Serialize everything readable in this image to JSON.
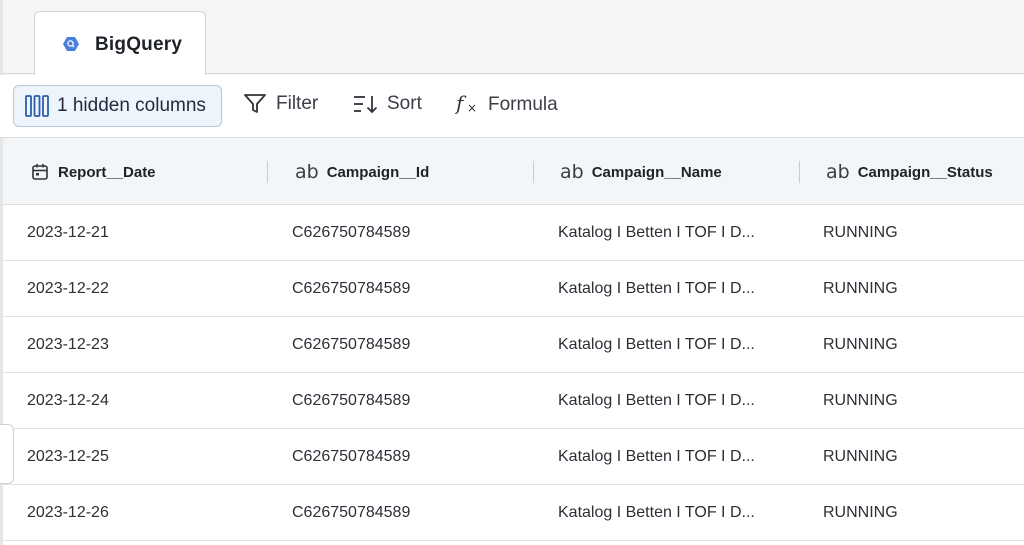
{
  "tab": {
    "label": "BigQuery",
    "icon": "bigquery-icon",
    "icon_color": "#4a7fdd"
  },
  "toolbar": {
    "hidden_columns_label": "1 hidden columns",
    "filter_label": "Filter",
    "sort_label": "Sort",
    "formula_label": "Formula",
    "accent_color": "#2d5ea8"
  },
  "table": {
    "columns": [
      {
        "label": "Report__Date",
        "type_icon": "calendar-icon"
      },
      {
        "label": "Campaign__Id",
        "type_icon": "ab"
      },
      {
        "label": "Campaign__Name",
        "type_icon": "ab"
      },
      {
        "label": "Campaign__Status",
        "type_icon": "ab"
      }
    ],
    "rows": [
      [
        "2023-12-21",
        "C626750784589",
        "Katalog I Betten I TOF I D...",
        "RUNNING"
      ],
      [
        "2023-12-22",
        "C626750784589",
        "Katalog I Betten I TOF I D...",
        "RUNNING"
      ],
      [
        "2023-12-23",
        "C626750784589",
        "Katalog I Betten I TOF I D...",
        "RUNNING"
      ],
      [
        "2023-12-24",
        "C626750784589",
        "Katalog I Betten I TOF I D...",
        "RUNNING"
      ],
      [
        "2023-12-25",
        "C626750784589",
        "Katalog I Betten I TOF I D...",
        "RUNNING"
      ],
      [
        "2023-12-26",
        "C626750784589",
        "Katalog I Betten I TOF I D...",
        "RUNNING"
      ]
    ]
  }
}
